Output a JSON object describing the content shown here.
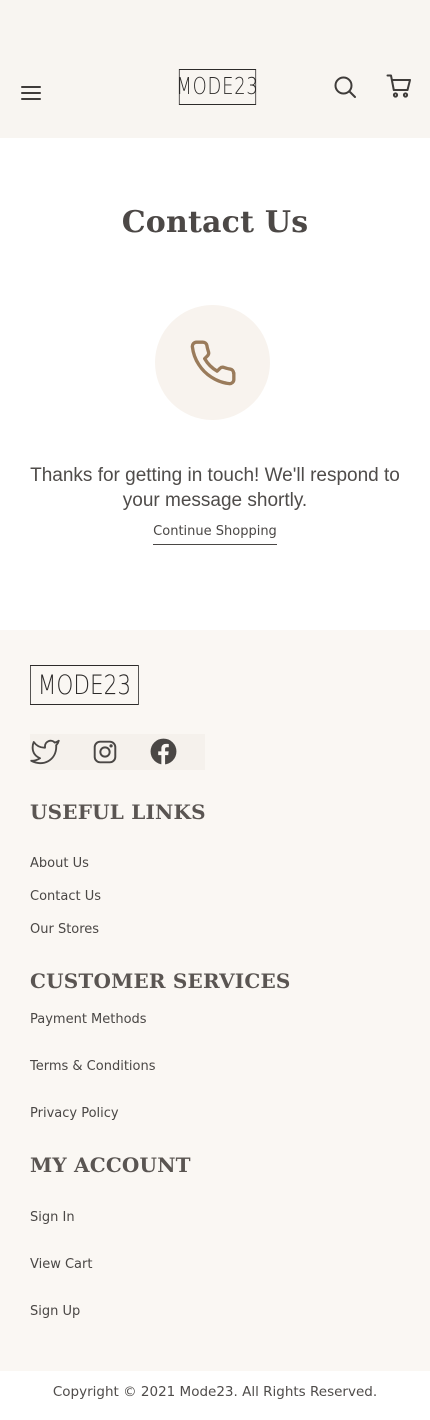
{
  "header": {
    "logo_text": "MODE23"
  },
  "main": {
    "title": "Contact Us",
    "message": "Thanks for getting in touch! We'll respond to your message shortly.",
    "continue_label": "Continue Shopping"
  },
  "footer": {
    "logo_text": "MODE23",
    "sections": [
      {
        "title": "USEFUL LINKS",
        "links": [
          "About Us",
          "Contact Us",
          "Our Stores"
        ]
      },
      {
        "title": "CUSTOMER SERVICES",
        "links": [
          "Payment Methods",
          "Terms & Conditions",
          "Privacy Policy"
        ]
      },
      {
        "title": "MY ACCOUNT",
        "links": [
          "Sign In",
          "View Cart",
          "Sign Up"
        ]
      }
    ],
    "copyright": "Copyright © 2021 Mode23. All Rights Reserved."
  },
  "colors": {
    "header_bg": "#f8f5f1",
    "footer_bg": "#faf7f3",
    "accent_brown": "#9a7b5b",
    "text_dark": "#4a4745"
  },
  "icons": [
    "menu-icon",
    "search-icon",
    "cart-icon",
    "phone-icon",
    "twitter-icon",
    "instagram-icon",
    "facebook-icon"
  ]
}
